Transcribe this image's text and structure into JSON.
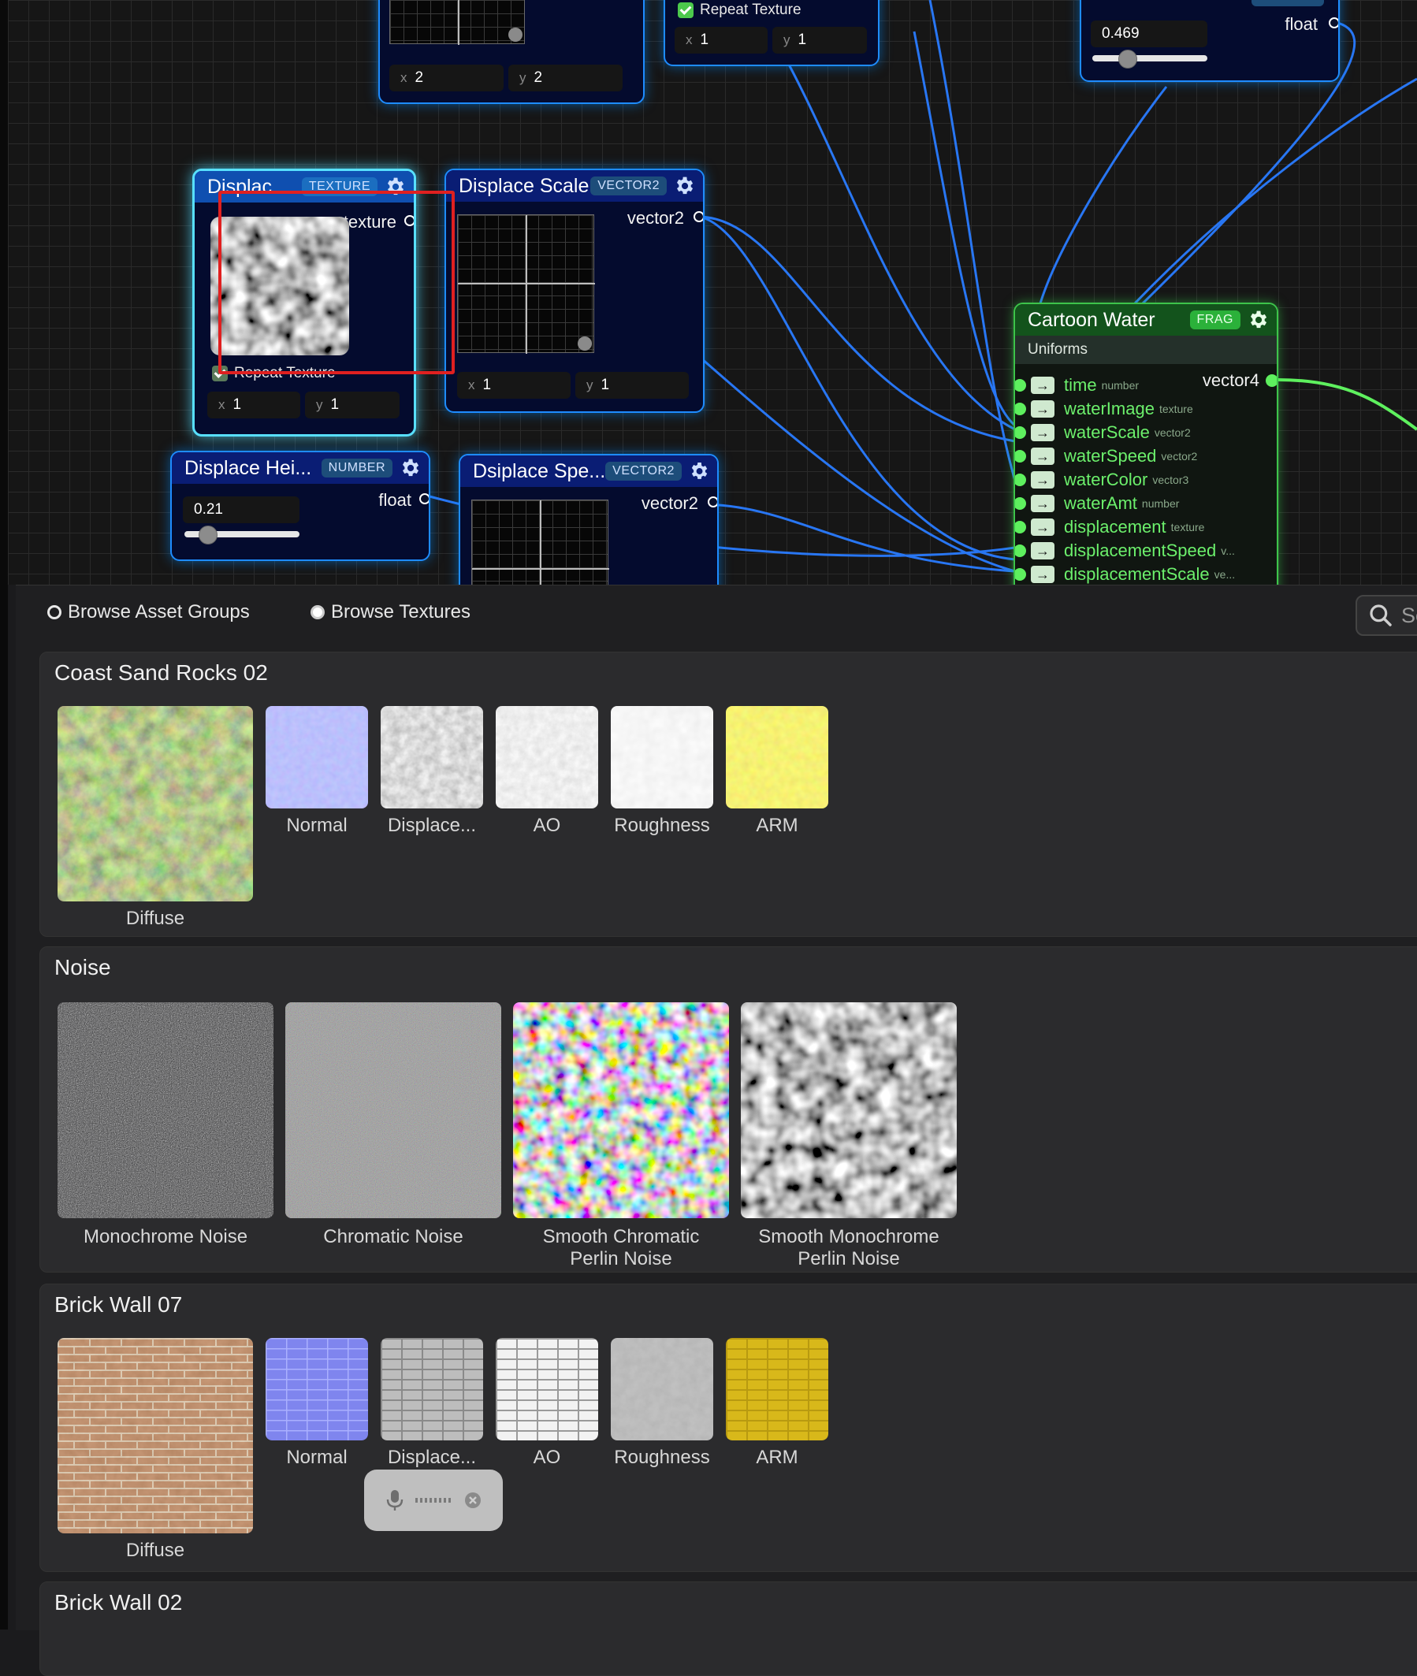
{
  "colors": {
    "node_border": "#1e8cff",
    "node_selected_border": "#58e0ff",
    "frag_border": "#3dc44a",
    "wire_blue": "#2a7cff",
    "wire_green": "#5ef05e",
    "highlight_red": "#e02020"
  },
  "graph": {
    "top_grid_node": {
      "x": "2",
      "y": "2"
    },
    "repeat_node": {
      "repeat_label": "Repeat Texture",
      "x": "1",
      "y": "1"
    },
    "float_node": {
      "value": "0.469",
      "slider_fraction": 0.3,
      "out_label": "float"
    },
    "displacement_texture": {
      "title": "Displac...",
      "tag": "TEXTURE",
      "out_label": "texture",
      "repeat_label": "Repeat Texture",
      "x": "1",
      "y": "1"
    },
    "displace_scale": {
      "title": "Displace Scale",
      "tag": "VECTOR2",
      "out_label": "vector2",
      "x": "1",
      "y": "1"
    },
    "displace_height": {
      "title": "Displace Hei...",
      "tag": "NUMBER",
      "value": "0.21",
      "slider_fraction": 0.2,
      "out_label": "float"
    },
    "displace_speed": {
      "title": "Dsiplace Spe...",
      "tag": "VECTOR2",
      "out_label": "vector2"
    },
    "cartoon_water": {
      "title": "Cartoon Water",
      "tag": "FRAG",
      "subtitle": "Uniforms",
      "out_label": "vector4",
      "uniforms": [
        {
          "name": "time",
          "type": "number"
        },
        {
          "name": "waterImage",
          "type": "texture"
        },
        {
          "name": "waterScale",
          "type": "vector2"
        },
        {
          "name": "waterSpeed",
          "type": "vector2"
        },
        {
          "name": "waterColor",
          "type": "vector3"
        },
        {
          "name": "waterAmt",
          "type": "number"
        },
        {
          "name": "displacement",
          "type": "texture"
        },
        {
          "name": "displacementSpeed",
          "type": "v..."
        },
        {
          "name": "displacementScale",
          "type": "ve..."
        }
      ]
    }
  },
  "browser": {
    "radio_groups": "Browse Asset Groups",
    "radio_textures": "Browse Textures",
    "search_placeholder": "Se",
    "groups": [
      {
        "title": "Coast Sand Rocks 02",
        "diffuse": "Diffuse",
        "maps": [
          "Normal",
          "Displace...",
          "AO",
          "Roughness",
          "ARM"
        ]
      },
      {
        "title": "Noise",
        "items": [
          "Monochrome Noise",
          "Chromatic Noise",
          "Smooth Chromatic\nPerlin Noise",
          "Smooth Monochrome\nPerlin Noise"
        ]
      },
      {
        "title": "Brick Wall 07",
        "diffuse": "Diffuse",
        "maps": [
          "Normal",
          "Displace...",
          "AO",
          "Roughness",
          "ARM"
        ]
      },
      {
        "title": "Brick Wall 02"
      }
    ]
  },
  "icons": [
    "gear-icon",
    "search-icon",
    "microphone-icon",
    "close-icon",
    "checkbox-icon",
    "arrow-right-icon"
  ]
}
